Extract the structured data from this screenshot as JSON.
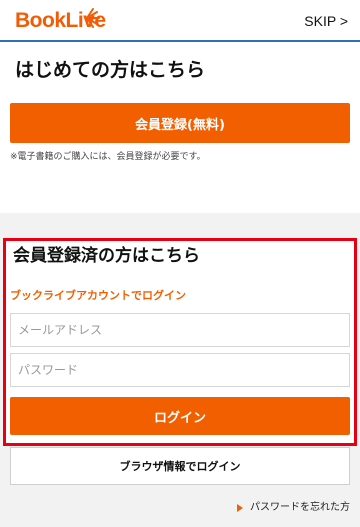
{
  "header": {
    "logo_text": "BookLive",
    "logo_icon": "burst-icon",
    "skip_label": "SKIP >"
  },
  "register": {
    "title": "はじめての方はこちら",
    "button_label": "会員登録(無料)",
    "note": "※電子書籍のご購入には、会員登録が必要です。"
  },
  "login": {
    "title": "会員登録済の方はこちら",
    "subtitle": "ブックライブアカウントでログイン",
    "email_placeholder": "メールアドレス",
    "password_placeholder": "パスワード",
    "button_label": "ログイン",
    "browser_login_label": "ブラウザ情報でログイン",
    "forgot_password": "パスワードを忘れた方"
  },
  "colors": {
    "accent": "#f25f00",
    "highlight_border": "#e60012",
    "header_line": "#2f6fb5"
  }
}
